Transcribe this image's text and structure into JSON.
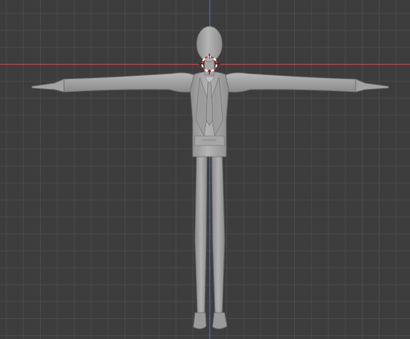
{
  "viewport": {
    "view": "front-orthographic",
    "background_color": "#3d3d3d",
    "grid_color": "#4a4a4a",
    "x_axis_color": "#b5414b",
    "z_axis_color": "#3d6fae",
    "show_grid": true
  },
  "scene": {
    "object": "humanoid-suit-figure",
    "pose": "T-pose",
    "mesh_color": "#a9a9a9",
    "shading": "solid",
    "selected": false
  },
  "cursor_3d": {
    "icon": "3d-cursor-icon",
    "ring_colors": [
      "#d33a3a",
      "#ffffff"
    ]
  }
}
